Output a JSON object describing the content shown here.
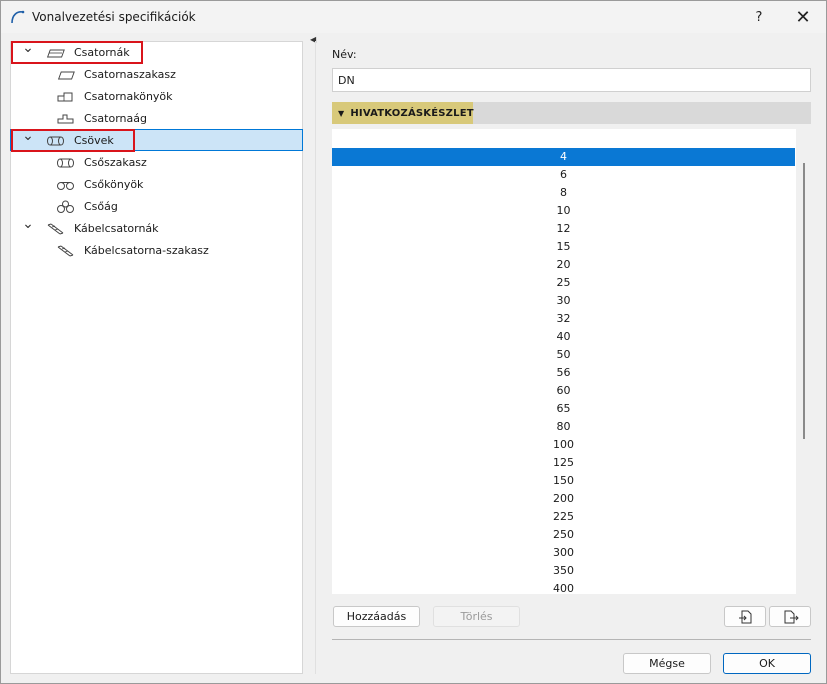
{
  "window": {
    "title": "Vonalvezetési specifikációk",
    "help_label": "?",
    "close_label": "✕"
  },
  "tree": {
    "items": [
      {
        "label": "Csatornák",
        "level": 0,
        "expanded": true,
        "icon": "duct-icon"
      },
      {
        "label": "Csatornaszakasz",
        "level": 1,
        "icon": "duct-segment-icon"
      },
      {
        "label": "Csatornakönyök",
        "level": 1,
        "icon": "duct-elbow-icon"
      },
      {
        "label": "Csatornaág",
        "level": 1,
        "icon": "duct-branch-icon"
      },
      {
        "label": "Csövek",
        "level": 0,
        "expanded": true,
        "selected": true,
        "icon": "pipe-icon"
      },
      {
        "label": "Csőszakasz",
        "level": 1,
        "icon": "pipe-segment-icon"
      },
      {
        "label": "Csőkönyök",
        "level": 1,
        "icon": "pipe-elbow-icon"
      },
      {
        "label": "Csőág",
        "level": 1,
        "icon": "pipe-branch-icon"
      },
      {
        "label": "Kábelcsatornák",
        "level": 0,
        "expanded": true,
        "icon": "cable-tray-icon"
      },
      {
        "label": "Kábelcsatorna-szakasz",
        "level": 1,
        "icon": "cable-tray-segment-icon"
      }
    ]
  },
  "form": {
    "name_label": "Név:",
    "name_value": "DN",
    "section_header": "HIVATKOZÁSKÉSZLET"
  },
  "reference_list": {
    "selected_index": 1,
    "items": [
      "",
      "4",
      "6",
      "8",
      "10",
      "12",
      "15",
      "20",
      "25",
      "30",
      "32",
      "40",
      "50",
      "56",
      "60",
      "65",
      "80",
      "100",
      "125",
      "150",
      "200",
      "225",
      "250",
      "300",
      "350",
      "400"
    ]
  },
  "buttons": {
    "add": "Hozzáadás",
    "delete": "Törlés",
    "cancel": "Mégse",
    "ok": "OK"
  },
  "colors": {
    "selection": "#0a78d4",
    "tree_selection": "#cce4f7",
    "section_header": "#d8c97a",
    "highlight_box": "#d9141b"
  }
}
